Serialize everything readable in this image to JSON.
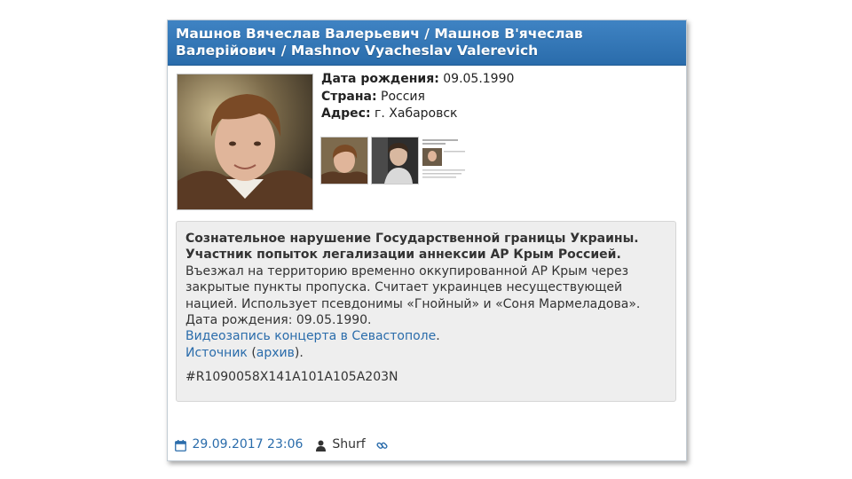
{
  "header": {
    "title": "Машнов Вячеслав Валерьевич / Машнов В'ячеслав Валерійович / Mashnov Vyacheslav Valerevich"
  },
  "profile": {
    "birth_label": "Дата рождения:",
    "birth_value": "09.05.1990",
    "country_label": "Страна:",
    "country_value": "Россия",
    "address_label": "Адрес:",
    "address_value": "г. Хабаровск"
  },
  "description": {
    "bold_line1": "Сознательное нарушение Государственной границы Украины.",
    "bold_line2": "Участник попыток легализации аннексии АР Крым Россией.",
    "text": "Въезжал на территорию временно оккупированной АР Крым через закрытые пункты пропуска. Считает украинцев несуществующей нацией. Использует псевдонимы «Гнойный» и «Соня Мармеладова».",
    "birth_line": "Дата рождения: 09.05.1990.",
    "video_link": "Видеозапись концерта в Севастополе",
    "video_suffix": ".",
    "source_link": "Источник",
    "source_mid": " (",
    "archive_link": "архив",
    "source_suffix": ").",
    "code": "#R1090058X141A101A105A203N"
  },
  "footer": {
    "datetime": "29.09.2017 23:06",
    "author": "Shurf"
  },
  "colors": {
    "header_blue": "#2a6cab",
    "link_blue": "#2a6cab",
    "description_bg": "#eeeeee"
  },
  "icons": [
    "calendar-icon",
    "user-icon",
    "link-icon"
  ]
}
